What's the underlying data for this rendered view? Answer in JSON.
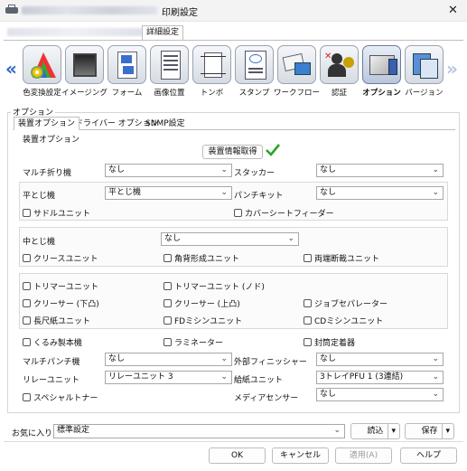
{
  "window": {
    "title": "印刷設定",
    "close_glyph": "✕",
    "subtab_label": "詳細設定"
  },
  "toolbar": {
    "prev_glyph": "«",
    "next_glyph": "»",
    "items": [
      {
        "label": "色変換設定",
        "icon": "color-conversion-icon"
      },
      {
        "label": "イメージング",
        "icon": "imaging-icon"
      },
      {
        "label": "フォーム",
        "icon": "form-icon"
      },
      {
        "label": "画像位置",
        "icon": "image-position-icon"
      },
      {
        "label": "トンボ",
        "icon": "crop-marks-icon"
      },
      {
        "label": "スタンプ",
        "icon": "stamp-icon"
      },
      {
        "label": "ワークフロー",
        "icon": "workflow-icon"
      },
      {
        "label": "認証",
        "icon": "authentication-icon"
      },
      {
        "label": "オプション",
        "icon": "option-icon",
        "active": true
      },
      {
        "label": "バージョン",
        "icon": "version-icon"
      }
    ]
  },
  "options": {
    "caption": "オプション",
    "tabs": [
      "装置オプション",
      "ドライバー オプション",
      "SNMP設定"
    ],
    "device_caption": "装置オプション",
    "get_device_info_button": "装置情報取得",
    "fields": {
      "multi_fold_label": "マルチ折り機",
      "multi_fold_value": "なし",
      "stacker_label": "スタッカー",
      "stacker_value": "なし",
      "flat_stitch_label": "平とじ機",
      "flat_stitch_value": "平とじ機",
      "punch_kit_label": "パンチキット",
      "punch_kit_value": "なし",
      "saddle_unit": "サドルユニット",
      "cover_sheet_feeder": "カバーシートフィーダー",
      "center_stitch_label": "中とじ機",
      "center_stitch_value": "なし",
      "crease_unit": "クリースユニット",
      "square_spine_unit": "角背形成ユニット",
      "both_edge_trim_unit": "両端断裁ユニット",
      "trimmer_unit": "トリマーユニット",
      "trimmer_unit_n": "トリマーユニット (ノド)",
      "creaser_down": "クリーサー (下凸)",
      "creaser_up": "クリーサー (上凸)",
      "job_separator": "ジョブセパレーター",
      "long_paper_unit": "長尺紙ユニット",
      "fd_perforation_unit": "FDミシンユニット",
      "cd_perforation_unit": "CDミシンユニット",
      "wrap_binder": "くるみ製本機",
      "laminator": "ラミネーター",
      "envelope_sealer": "封筒定着器",
      "multi_punch_label": "マルチパンチ機",
      "multi_punch_value": "なし",
      "external_finisher_label": "外部フィニッシャー",
      "external_finisher_value": "なし",
      "relay_unit_label": "リレーユニット",
      "relay_unit_value": "リレーユニット 3",
      "paper_feed_unit_label": "給紙ユニット",
      "paper_feed_unit_value": "3トレイPFU 1 (3連結)",
      "special_toner": "スペシャルトナー",
      "media_sensor_label": "メディアセンサー",
      "media_sensor_value": "なし"
    }
  },
  "favorites": {
    "label": "お気に入り",
    "value": "標準設定",
    "load_button": "読込",
    "save_button": "保存"
  },
  "footer": {
    "ok": "OK",
    "cancel": "キャンセル",
    "apply": "適用(A)",
    "help": "ヘルプ"
  }
}
